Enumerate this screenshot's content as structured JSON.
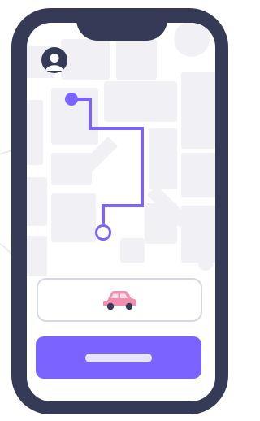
{
  "colors": {
    "frame": "#353a57",
    "accent": "#7b63ff",
    "map_block": "#f1f1f5",
    "car_body": "#f28fb0",
    "card_border": "#d5d7e6"
  },
  "icons": {
    "profile": "user-avatar-icon",
    "vehicle": "car-icon",
    "route_start": "route-start-dot",
    "route_end": "route-end-ring"
  }
}
